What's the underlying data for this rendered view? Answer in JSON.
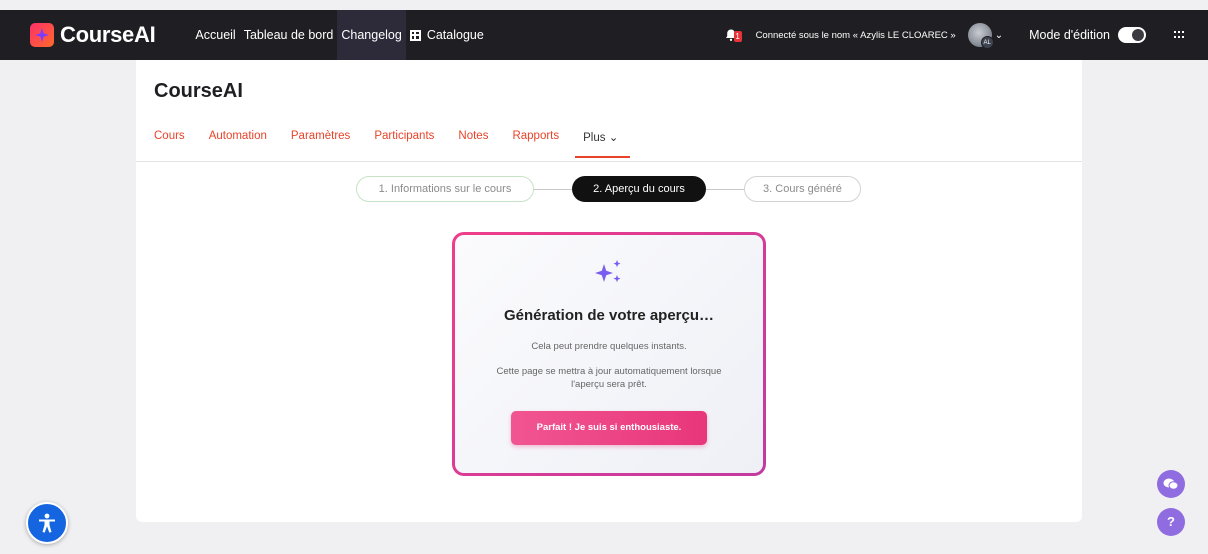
{
  "brand": {
    "name": "CourseAI"
  },
  "topnav": {
    "links": [
      "Accueil",
      "Tableau de bord",
      "Changelog",
      "Catalogue"
    ],
    "notification_count": "1",
    "user_text": "Connecté sous le nom « Azylis LE CLOAREC »",
    "avatar_initials": "AL",
    "edit_mode_label": "Mode d'édition",
    "edit_mode_on": true
  },
  "course": {
    "title": "CourseAI"
  },
  "tabs": [
    "Cours",
    "Automation",
    "Paramètres",
    "Participants",
    "Notes",
    "Rapports",
    "Plus ⌄"
  ],
  "stepper": {
    "steps": [
      "1. Informations sur le cours",
      "2. Aperçu du cours",
      "3. Cours généré"
    ],
    "current": 2
  },
  "generation": {
    "title": "Génération de votre aperçu…",
    "subtitle": "Cela peut prendre quelques instants.",
    "note": "Cette page se mettra à jour automatiquement lorsque l'aperçu sera prêt.",
    "button": "Parfait ! Je suis si enthousiaste."
  },
  "widgets": {
    "help_label": "?"
  },
  "colors": {
    "accent": "#e8432a",
    "brand_pink": "#ef3d8a",
    "widget_purple": "#8f6ce0",
    "a11y_blue": "#1565e0"
  }
}
